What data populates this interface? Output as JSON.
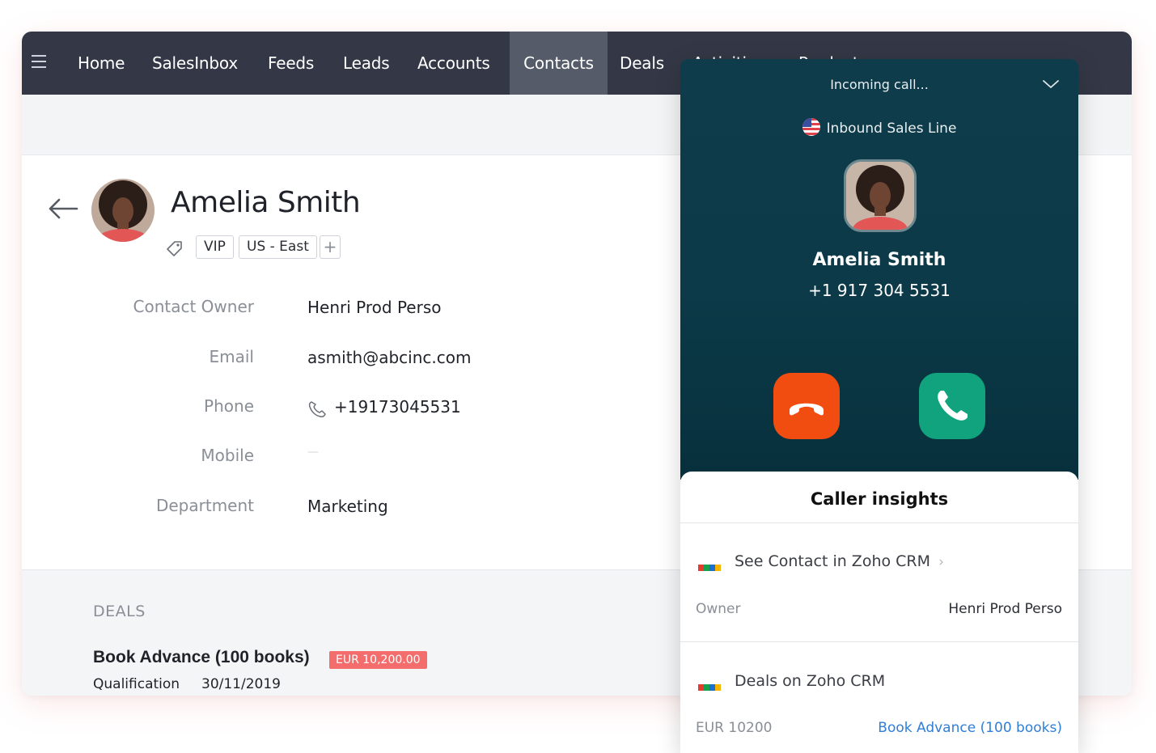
{
  "nav": {
    "items": [
      "Home",
      "SalesInbox",
      "Feeds",
      "Leads",
      "Accounts",
      "Contacts",
      "Deals",
      "Activities",
      "Products"
    ],
    "active": "Contacts"
  },
  "contact": {
    "name": "Amelia Smith",
    "tags": [
      "VIP",
      "US - East"
    ],
    "add_tag": "+",
    "fields": [
      {
        "label": "Contact Owner",
        "value": "Henri Prod Perso"
      },
      {
        "label": "Email",
        "value": "asmith@abcinc.com"
      },
      {
        "label": "Phone",
        "value": "+19173045531"
      },
      {
        "label": "Mobile",
        "value": "—"
      },
      {
        "label": "Department",
        "value": "Marketing"
      }
    ]
  },
  "deals": {
    "heading": "DEALS",
    "items": [
      {
        "title": "Book Advance (100 books)",
        "amount": "EUR 10,200.00",
        "stage": "Qualification",
        "date": "30/11/2019"
      }
    ]
  },
  "call": {
    "status": "Incoming call...",
    "line": "Inbound Sales Line",
    "caller_name": "Amelia Smith",
    "caller_number": "+1 917 304 5531",
    "decline_color": "#f24d11",
    "accept_color": "#11a37e"
  },
  "insights": {
    "title": "Caller insights",
    "crm_link": "See Contact in Zoho CRM",
    "owner_label": "Owner",
    "owner_value": "Henri Prod Perso",
    "deals_link": "Deals on Zoho CRM",
    "deal_amount": "EUR 10200",
    "deal_name": "Book Advance (100 books)"
  }
}
